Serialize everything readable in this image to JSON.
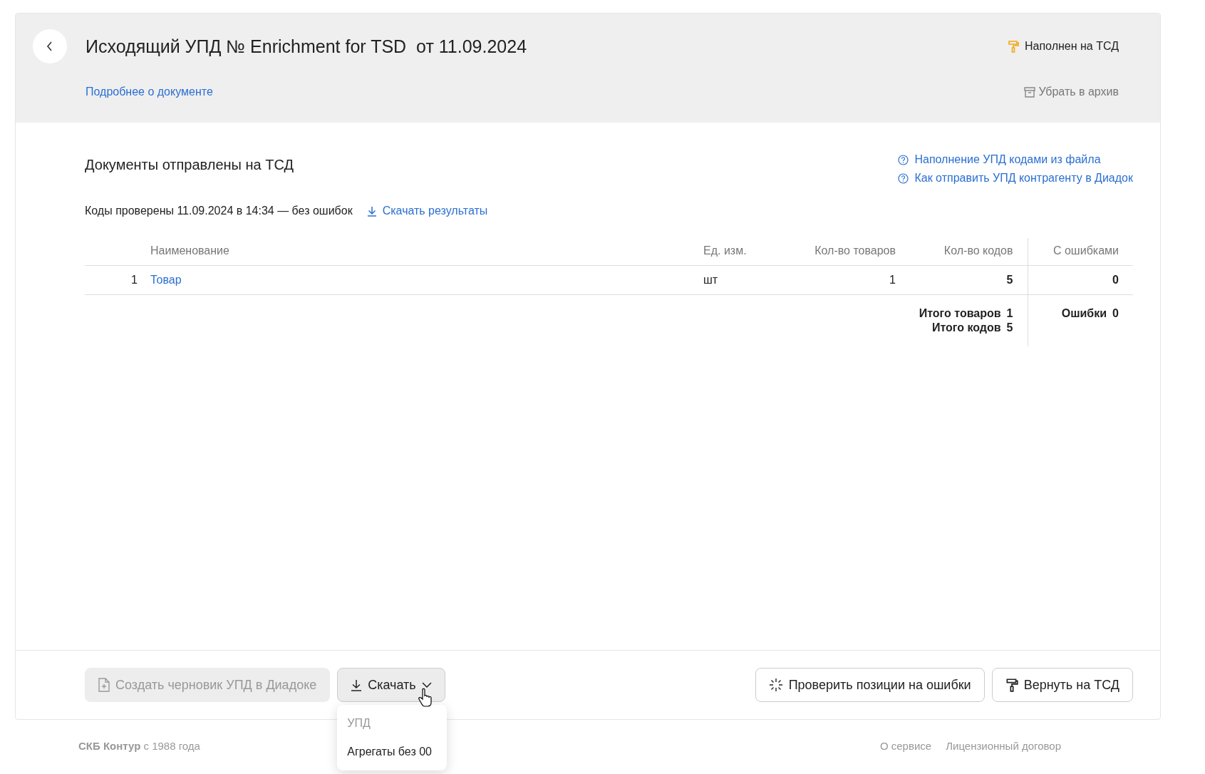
{
  "header": {
    "title": "Исходящий УПД № Enrichment for TSD  от 11.09.2024",
    "details_link": "Подробнее о документе",
    "status": "Наполнен на ТСД",
    "archive": "Убрать в архив"
  },
  "section": {
    "title": "Документы отправлены на ТСД",
    "help_links": [
      "Наполнение УПД кодами из файла",
      "Как отправить УПД контрагенту в Диадок"
    ],
    "check_text": "Коды проверены 11.09.2024 в 14:34 — без ошибок",
    "download_results": "Скачать результаты"
  },
  "table": {
    "columns": [
      "Наименование",
      "Ед. изм.",
      "Кол-во товаров",
      "Кол-во кодов",
      "С ошибками"
    ],
    "rows": [
      {
        "number": "1",
        "name": "Товар",
        "unit": "шт",
        "qty": "1",
        "codes": "5",
        "errors": "0"
      }
    ],
    "totals": [
      {
        "label": "Итого товаров",
        "value": "1"
      },
      {
        "label": "Итого кодов",
        "value": "5"
      }
    ],
    "errors_total": {
      "label": "Ошибки",
      "value": "0"
    }
  },
  "actions": {
    "create_draft": {
      "label": "Создать черновик УПД в Диадоке",
      "disabled": true
    },
    "download": {
      "label": "Скачать",
      "expanded": true
    },
    "check": "Проверить позиции на ошибки",
    "return": "Вернуть на ТСД"
  },
  "menu": [
    {
      "label": "УПД",
      "disabled": true
    },
    {
      "label": "Агрегаты без 00",
      "disabled": false
    }
  ],
  "footer": {
    "brand": "СКБ Контур",
    "since": "с 1988 года",
    "links": [
      "О сервисе",
      "Лицензионный договор"
    ]
  }
}
